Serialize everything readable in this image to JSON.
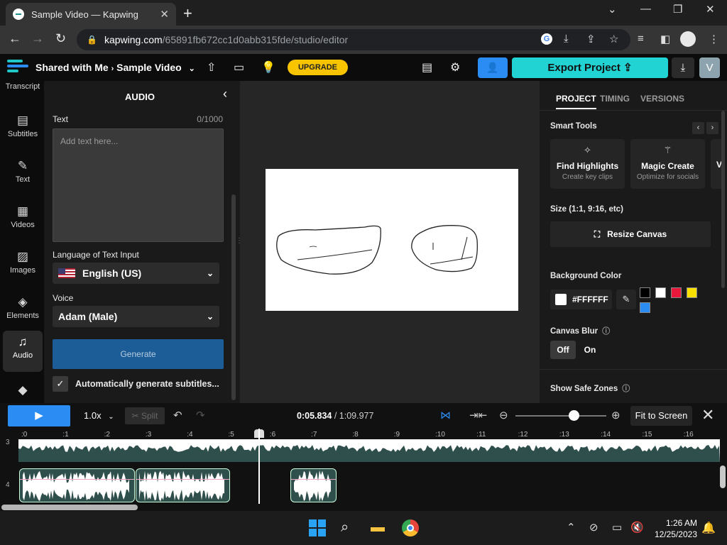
{
  "browser": {
    "tab_title": "Sample Video — Kapwing",
    "url_host": "kapwing.com",
    "url_path": "/65891fb672cc1d0abb315fde/studio/editor"
  },
  "header": {
    "breadcrumb_parent": "Shared with Me",
    "breadcrumb_project": "Sample Video",
    "upgrade_label": "UPGRADE",
    "export_label": "Export Project",
    "avatar_letter": "V"
  },
  "rail": [
    {
      "label": "Transcript",
      "icon": "transcript-icon"
    },
    {
      "label": "Subtitles",
      "icon": "subtitles-icon"
    },
    {
      "label": "Text",
      "icon": "text-icon"
    },
    {
      "label": "Videos",
      "icon": "videos-icon"
    },
    {
      "label": "Images",
      "icon": "images-icon"
    },
    {
      "label": "Elements",
      "icon": "elements-icon"
    },
    {
      "label": "Audio",
      "icon": "audio-icon"
    }
  ],
  "audio_panel": {
    "title": "AUDIO",
    "text_label": "Text",
    "counter": "0/1000",
    "placeholder": "Add text here...",
    "language_label": "Language of Text Input",
    "language_value": "English (US)",
    "voice_label": "Voice",
    "voice_value": "Adam (Male)",
    "generate_label": "Generate",
    "auto_subtitles_label": "Automatically generate subtitles..."
  },
  "right_panel": {
    "tabs": [
      "PROJECT",
      "TIMING",
      "VERSIONS"
    ],
    "smart_tools_label": "Smart Tools",
    "tools": [
      {
        "title": "Find Highlights",
        "subtitle": "Create key clips"
      },
      {
        "title": "Magic Create",
        "subtitle": "Optimize for socials"
      },
      {
        "title": "V",
        "subtitle": ""
      }
    ],
    "size_label": "Size (1:1, 9:16, etc)",
    "resize_label": "Resize Canvas",
    "bg_label": "Background Color",
    "bg_value": "#FFFFFF",
    "swatches": [
      "#000000",
      "#ffffff",
      "#e8183c",
      "#f8e000",
      "#2b8cf3"
    ],
    "blur_label": "Canvas Blur",
    "blur_off": "Off",
    "blur_on": "On",
    "safe_zones_label": "Show Safe Zones"
  },
  "timeline": {
    "speed": "1.0x",
    "split_label": "Split",
    "current_time": "0:05.834",
    "total_time": "1:09.977",
    "fit_label": "Fit to Screen",
    "ticks": [
      ":0",
      ":1",
      ":2",
      ":3",
      ":4",
      ":5",
      ":6",
      ":7",
      ":8",
      ":9",
      ":10",
      ":11",
      ":12",
      ":13",
      ":14",
      ":15",
      ":16"
    ],
    "rows": [
      "3",
      "4"
    ],
    "playhead_seconds": 5.834
  },
  "taskbar": {
    "time": "1:26 AM",
    "date": "12/25/2023"
  }
}
